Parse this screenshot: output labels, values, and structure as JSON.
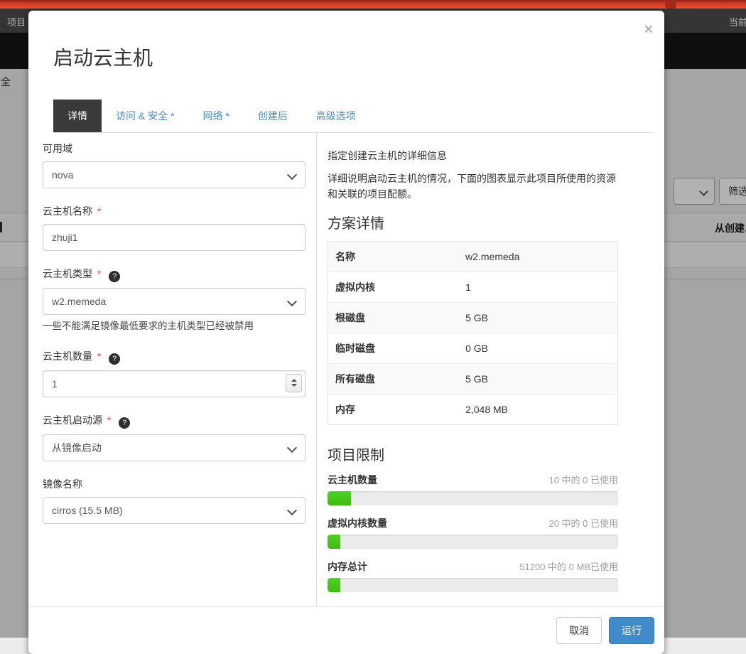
{
  "background": {
    "navbar_left": "项目",
    "navbar_right": "当前",
    "side_text": "全",
    "filter_button": "筛选",
    "table_header": "从创建以"
  },
  "icons": {
    "close": "×",
    "help": "?"
  },
  "modal": {
    "title": "启动云主机",
    "tabs": [
      {
        "label": "详情"
      },
      {
        "label": "访问 & 安全 *"
      },
      {
        "label": "网络 *"
      },
      {
        "label": "创建后"
      },
      {
        "label": "高级选项"
      }
    ],
    "form": {
      "availability_zone": {
        "label": "可用域",
        "value": "nova"
      },
      "instance_name": {
        "label": "云主机名称",
        "required_mark": "*",
        "value": "zhuji1"
      },
      "flavor": {
        "label": "云主机类型",
        "required_mark": "*",
        "value": "w2.memeda",
        "hint": "一些不能满足镜像最低要求的主机类型已经被禁用"
      },
      "count": {
        "label": "云主机数量",
        "required_mark": "*",
        "value": "1"
      },
      "boot_source": {
        "label": "云主机启动源",
        "required_mark": "*",
        "value": "从镜像启动"
      },
      "image": {
        "label": "镜像名称",
        "value": "cirros (15.5 MB)"
      }
    },
    "details": {
      "intro": "指定创建云主机的详细信息",
      "description": "详细说明启动云主机的情况，下面的图表显示此项目所使用的资源和关联的项目配额。",
      "flavor_section_title": "方案详情",
      "flavor_rows": [
        {
          "label": "名称",
          "value": "w2.memeda"
        },
        {
          "label": "虚拟内核",
          "value": "1"
        },
        {
          "label": "根磁盘",
          "value": "5 GB"
        },
        {
          "label": "临时磁盘",
          "value": "0 GB"
        },
        {
          "label": "所有磁盘",
          "value": "5 GB"
        },
        {
          "label": "内存",
          "value": "2,048 MB"
        }
      ],
      "limits_section_title": "项目限制",
      "quotas": [
        {
          "label": "云主机数量",
          "usage": "10 中的 0 已使用",
          "percent": 8
        },
        {
          "label": "虚拟内核数量",
          "usage": "20 中的 0 已使用",
          "percent": 4.5
        },
        {
          "label": "内存总计",
          "usage": "51200 中的 0 MB已使用",
          "percent": 4.5
        }
      ]
    },
    "footer": {
      "cancel": "取消",
      "launch": "运行"
    }
  },
  "colors": {
    "top_bar_red": "#ee4f2d",
    "tab_active_bg": "#3a3a3c",
    "link_blue": "#428bca",
    "quota_green": "#44cc11",
    "primary_button_blue": "#428bca"
  }
}
